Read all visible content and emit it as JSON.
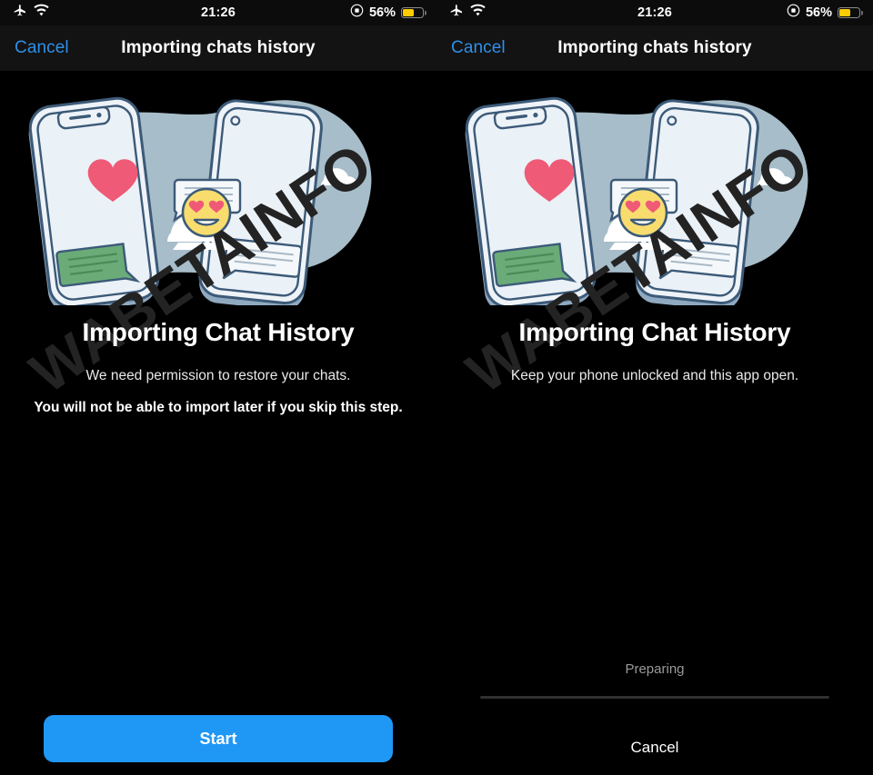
{
  "status_bar": {
    "airplane_icon": "airplane-mode-icon",
    "wifi_icon": "wifi-icon",
    "time": "21:26",
    "orientation_lock_icon": "rotation-lock-icon",
    "battery_percent": "56%",
    "battery_level": 56,
    "battery_color": "#ffcc00"
  },
  "nav": {
    "cancel_label": "Cancel",
    "title": "Importing chats history",
    "accent_color": "#2f8fe8"
  },
  "watermark": {
    "text": "WABETAINFO",
    "color": "#232323"
  },
  "illustration": {
    "name": "two-phones-chat-transfer-illustration",
    "blob_color": "#a7bdc9",
    "phone_body_color": "#eef3f8",
    "phone_outline_color": "#3c5a78",
    "phone_shadow_color": "#8fa9c0",
    "heart_color": "#ef5a76",
    "emoji_color": "#f8dd6e",
    "green_bubble_color": "#6aab78",
    "cloud_color": "#ffffff",
    "bubble_color": "#f4f8fb"
  },
  "left_screen": {
    "headline": "Importing Chat History",
    "subline": "We need permission to restore your chats.",
    "warning": "You will not be able to import later if you skip this step.",
    "primary_button": "Start",
    "primary_button_color": "#1f97f5"
  },
  "right_screen": {
    "headline": "Importing Chat History",
    "subline": "Keep your phone unlocked and this app open.",
    "progress_label": "Preparing",
    "progress_percent": 0,
    "progress_track_color": "#303030",
    "cancel_label": "Cancel"
  }
}
